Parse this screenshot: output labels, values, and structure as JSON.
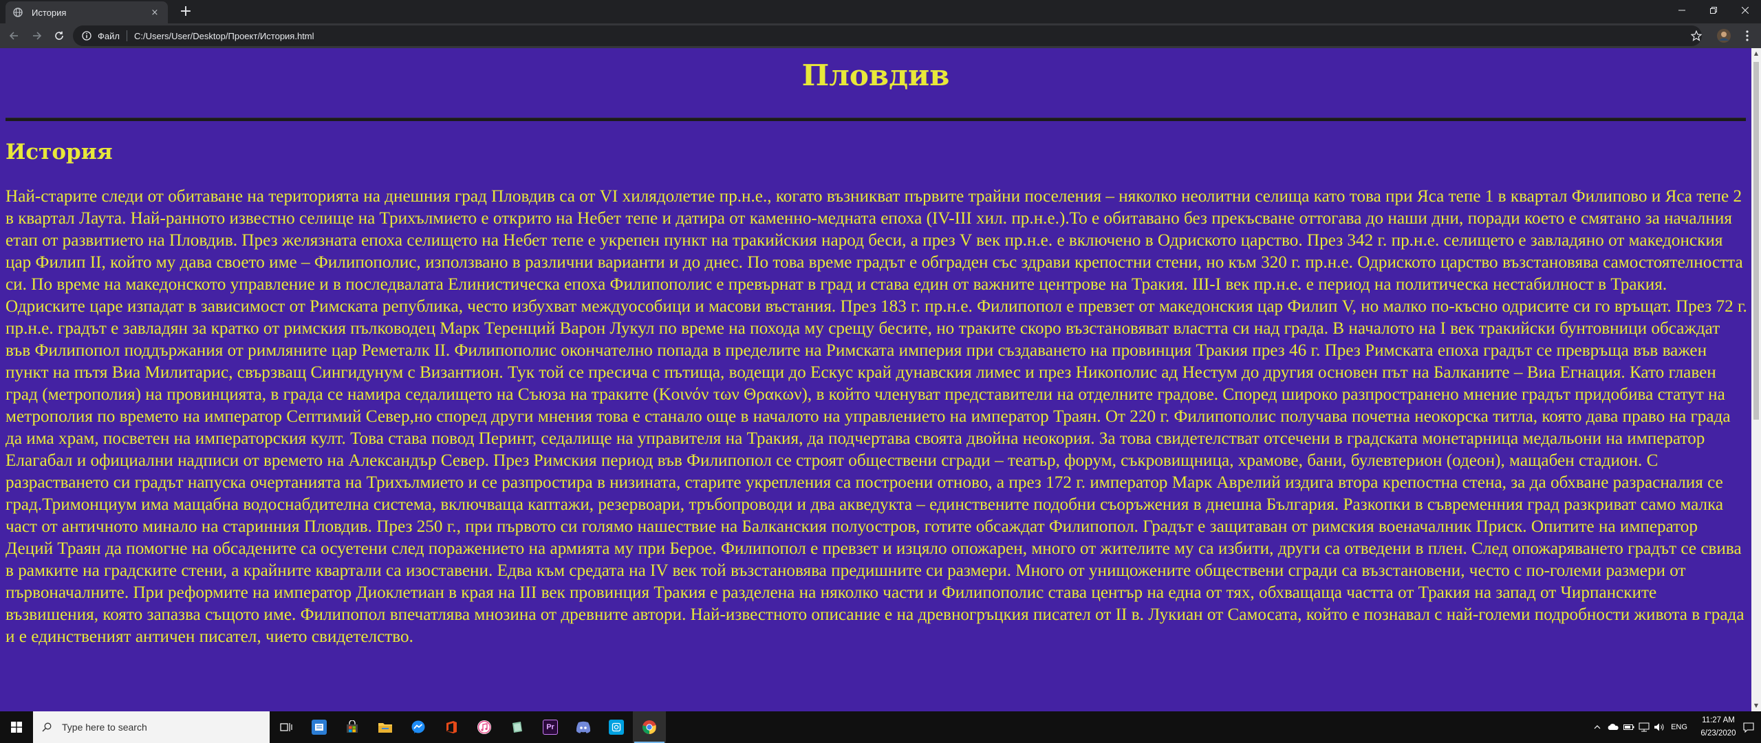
{
  "browser": {
    "tab": {
      "title": "История",
      "favicon": "globe-icon",
      "close": "×"
    },
    "new_tab": "+",
    "omnibox": {
      "scheme_label": "Файл",
      "url": "C:/Users/User/Desktop/Проект/История.html"
    }
  },
  "page": {
    "background_color": "#4422a3",
    "text_color": "#e8e83a",
    "heading": "Пловдив",
    "subheading": "История",
    "paragraph": "Най-старите следи от обитаване на територията на днешния град Пловдив са от VI хилядолетие пр.н.е., когато възникват първите трайни поселения – няколко неолитни селища като това при Яса тепе 1 в квартал Филипово и Яса тепе 2 в квартал Лаута. Най-ранното известно селище на Трихълмието е открито на Небет тепе и датира от каменно-медната епоха (IV-III хил. пр.н.е.).То е обитавано без прекъсване оттогава до наши дни, поради което е смятано за началния етап от развитието на Пловдив. През желязната епоха селището на Небет тепе е укрепен пункт на тракийския народ беси, а през V век пр.н.е. е включено в Одриското царство. През 342 г. пр.н.е. селището е завладяно от македонския цар Филип II, който му дава своето име – Филипополис, използвано в различни варианти и до днес. По това време градът е обграден със здрави крепостни стени, но към 320 г. пр.н.е. Одриското царство възстановява самостоятелността си. По време на македонското управление и в последвалата Елинистическа епоха Филипополис е превърнат в град и става един от важните центрове на Тракия. III-I век пр.н.е. е период на политическа нестабилност в Тракия. Одриските царе изпадат в зависимост от Римската република, често избухват междуособици и масови въстания. През 183 г. пр.н.е. Филипопол е превзет от македонския цар Филип V, но малко по-късно одрисите си го връщат. През 72 г. пр.н.е. градът е завладян за кратко от римския пълководец Марк Теренций Варон Лукул по време на похода му срещу бесите, но траките скоро възстановяват властта си над града. В началото на I век тракийски бунтовници обсаждат във Филипопол поддържания от римляните цар Реметалк II. Филипополис окончателно попада в пределите на Римската империя при създаването на провинция Тракия през 46 г. През Римската епоха градът се превръща във важен пункт на пътя Виа Милитарис, свързващ Сингидунум с Византион. Тук той се пресича с пътища, водещи до Ескус край дунавския лимес и през Никополис ад Нестум до другия основен път на Балканите – Виа Егнация. Като главен град (метрополия) на провинцията, в града се намира седалището на Съюза на траките (Κοινόν των Θρακων), в който членуват представители на отделните градове. Според широко разпространено мнение градът придобива статут на метрополия по времето на император Септимий Север,но според други мнения това е станало още в началото на управлението на император Траян. От 220 г. Филипополис получава почетна неокорска титла, която дава право на града да има храм, посветен на императорския култ. Това става повод Перинт, седалище на управителя на Тракия, да подчертава своята двойна неокория. За това свидетелстват отсечени в градската монетарница медальони на император Елагабал и официални надписи от времето на Александър Север. През Римския период във Филипопол се строят обществени сгради – театър, форум, съкровищница, храмове, бани, булевтерион (одеон), мащабен стадион. С разрастването си градът напуска очертанията на Трихълмието и се разпростира в низината, старите укрепления са построени отново, а през 172 г. император Марк Аврелий издига втора крепостна стена, за да обхване разрасналия се град.Тримонциум има мащабна водоснабдителна система, включваща каптажи, резервоари, тръбопроводи и два акведукта – единствените подобни съоръжения в днешна България. Разкопки в съвременния град разкриват само малка част от античното минало на старинния Пловдив. През 250 г., при първото си голямо нашествие на Балканския полуостров, готите обсаждат Филипопол. Градът е защитаван от римския военачалник Приск. Опитите на император Деций Траян да помогне на обсадените са осуетени след поражението на армията му при Бероe. Филипопол е превзет и изцяло опожарен, много от жителите му са избити, други са отведени в плен. След опожаряването градът се свива в рамките на градските стени, а крайните квартали са изоставени. Едва към средата на IV век той възстановява предишните си размери. Много от унищожените обществени сгради са възстановени, често с по-големи размери от първоначалните. При реформите на император Диоклетиан в края на III век провинция Тракия е разделена на няколко части и Филипополис става център на една от тях, обхващаща частта от Тракия на запад от Чирпанските възвишения, която запазва същото име. Филипопол впечатлява мнозина от древните автори. Най-известното описание е на древногръцкия писател от II в. Лукиан от Самосата, който е познавал с най-големи подробности живота в града и е единственият античен писател, чието свидетелство."
  },
  "taskbar": {
    "search_placeholder": "Type here to search",
    "apps": [
      "task-view-icon",
      "news-icon",
      "store-icon",
      "file-explorer-icon",
      "messenger-icon",
      "office-icon",
      "itunes-icon",
      "notes-icon",
      "premiere-icon",
      "discord-icon",
      "camera-icon",
      "chrome-icon"
    ],
    "premiere_label": "Pr",
    "language": "ENG",
    "time": "11:27 AM",
    "date": "6/23/2020"
  }
}
